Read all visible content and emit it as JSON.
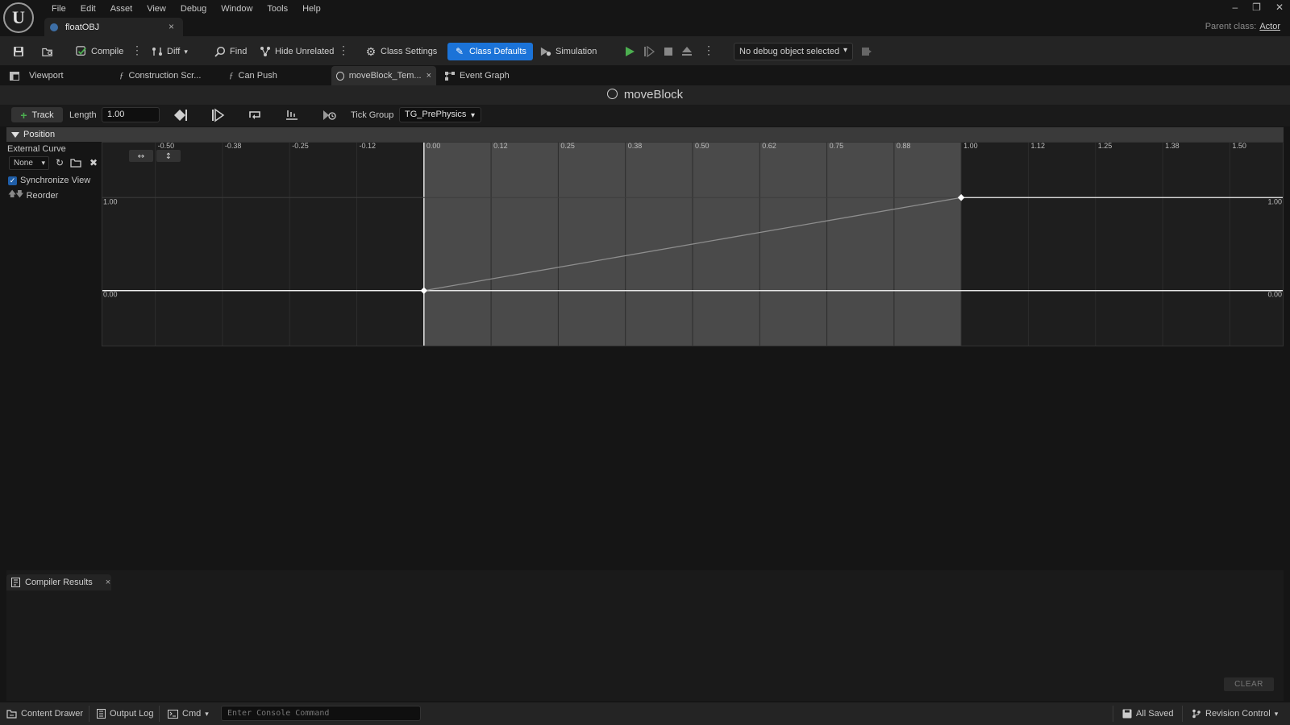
{
  "app": {
    "logo": "U",
    "menu": [
      "File",
      "Edit",
      "Asset",
      "View",
      "Debug",
      "Window",
      "Tools",
      "Help"
    ],
    "document_tab": "floatOBJ",
    "tab_close": "×",
    "parent_class_label": "Parent class:",
    "parent_class_value": "Actor",
    "window_controls": {
      "minimize": "–",
      "restore": "❐",
      "close": "✕"
    }
  },
  "toolbar": {
    "compile": "Compile",
    "diff": "Diff",
    "find": "Find",
    "hide_unrelated": "Hide Unrelated",
    "class_settings": "Class Settings",
    "class_defaults": "Class Defaults",
    "simulation": "Simulation",
    "debug_object": "No debug object selected",
    "accent_color": "#1b73d8",
    "play_color": "#4caf50"
  },
  "mode_tabs": {
    "viewport": "Viewport",
    "construction_script": "Construction Scr...",
    "can_push": "Can Push",
    "timeline_tab": "moveBlock_Tem...",
    "event_graph": "Event Graph",
    "tab_close": "×"
  },
  "timeline": {
    "title": "moveBlock",
    "add_track": "Track",
    "length_label": "Length",
    "length_value": "1.00",
    "tick_group_label": "Tick Group",
    "tick_group_value": "TG_PrePhysics",
    "track_name": "Position",
    "external_curve_label": "External Curve",
    "external_curve_value": "None",
    "synchronize_view": "Synchronize View",
    "reorder": "Reorder"
  },
  "curve": {
    "time_ticks": [
      "-0.50",
      "-0.38",
      "-0.25",
      "-0.12",
      "0.00",
      "0.12",
      "0.25",
      "0.38",
      "0.50",
      "0.62",
      "0.75",
      "0.88",
      "1.00",
      "1.12",
      "1.25",
      "1.38",
      "1.50"
    ],
    "time_tick_values": [
      -0.5,
      -0.375,
      -0.25,
      -0.125,
      0,
      0.125,
      0.25,
      0.375,
      0.5,
      0.625,
      0.75,
      0.875,
      1.0,
      1.125,
      1.25,
      1.375,
      1.5
    ],
    "value_labels": [
      "1.00",
      "0.00"
    ],
    "value_label_values": [
      1.0,
      0.0
    ],
    "time_range": [
      -0.6,
      1.6
    ],
    "value_range": [
      -0.6,
      1.6
    ],
    "active_range": [
      0,
      1
    ],
    "keys": [
      {
        "time": 0,
        "value": 0
      },
      {
        "time": 1,
        "value": 1
      }
    ]
  },
  "compiler": {
    "tab_label": "Compiler Results",
    "tab_close": "×",
    "clear": "CLEAR"
  },
  "statusbar": {
    "content_drawer": "Content Drawer",
    "output_log": "Output Log",
    "cmd": "Cmd",
    "console_placeholder": "Enter Console Command",
    "all_saved": "All Saved",
    "revision_control": "Revision Control"
  }
}
